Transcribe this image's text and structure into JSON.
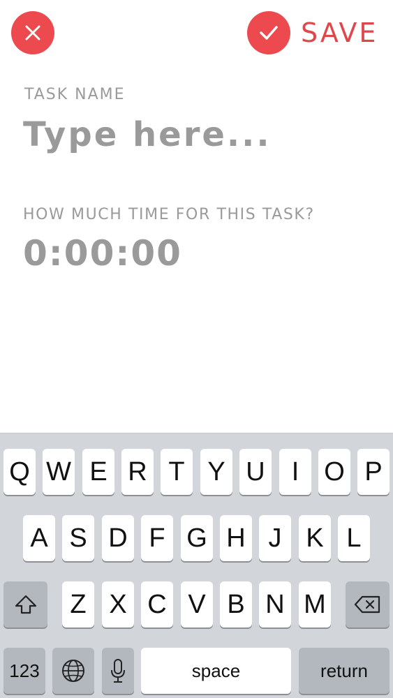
{
  "header": {
    "close_icon": "close-icon",
    "save_icon": "check-icon",
    "save_label": "SAVE",
    "accent_color": "#ec4a4f"
  },
  "form": {
    "task_label": "TASK NAME",
    "task_placeholder": "Type here...",
    "time_label": "HOW MUCH TIME FOR THIS TASK?",
    "time_value": "0:00:00"
  },
  "keyboard": {
    "row1": [
      "Q",
      "W",
      "E",
      "R",
      "T",
      "Y",
      "U",
      "I",
      "O",
      "P"
    ],
    "row2": [
      "A",
      "S",
      "D",
      "F",
      "G",
      "H",
      "J",
      "K",
      "L"
    ],
    "row3": [
      "Z",
      "X",
      "C",
      "V",
      "B",
      "N",
      "M"
    ],
    "numbers_label": "123",
    "space_label": "space",
    "return_label": "return",
    "shift_icon": "shift-icon",
    "delete_icon": "backspace-icon",
    "globe_icon": "globe-icon",
    "mic_icon": "microphone-icon"
  }
}
